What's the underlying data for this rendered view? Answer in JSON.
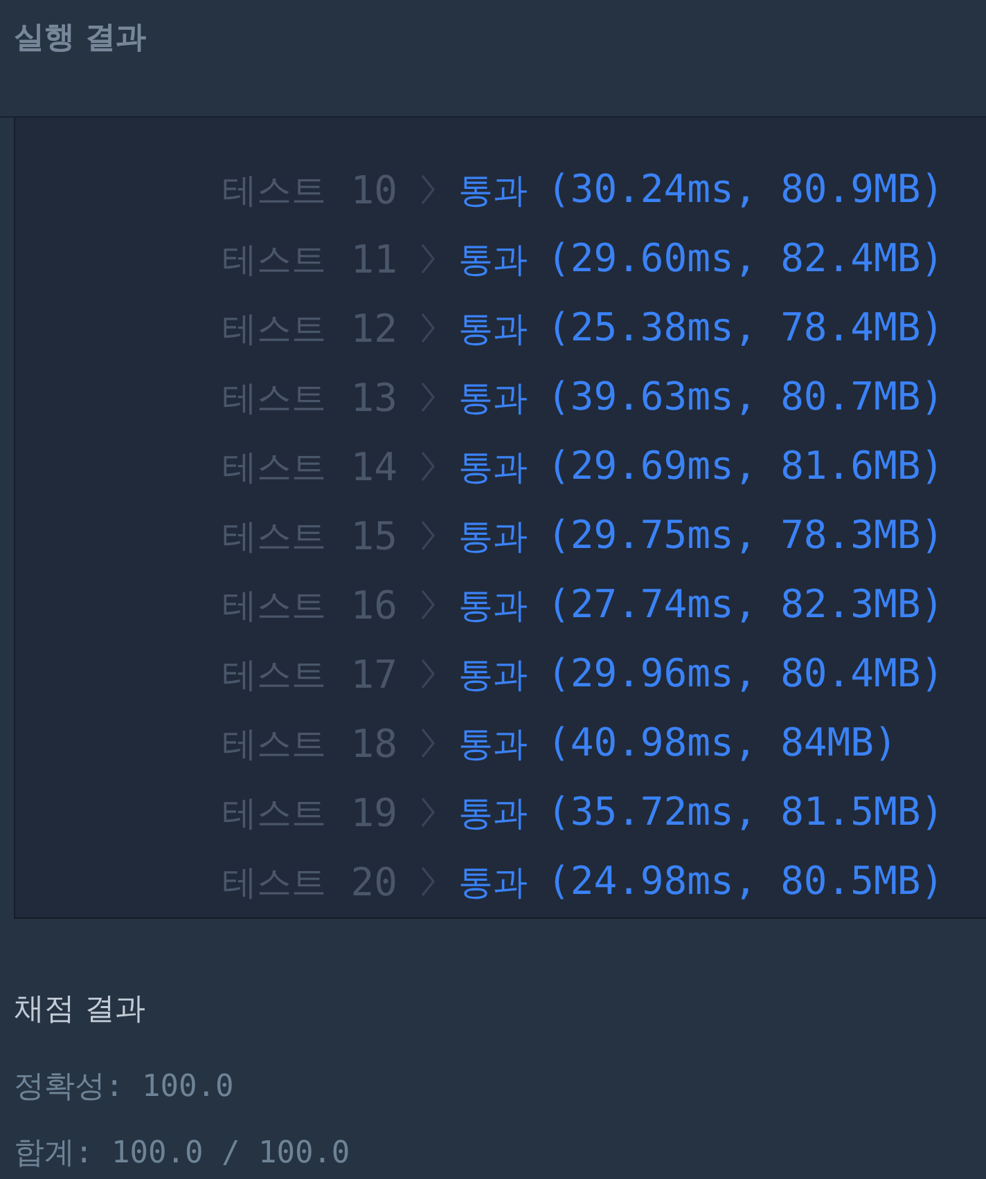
{
  "header": {
    "title": "실행 결과"
  },
  "results": [
    {
      "label": "테스트",
      "number": "10",
      "status": "통과",
      "detail": "(30.24ms, 80.9MB)",
      "passed": true
    },
    {
      "label": "테스트",
      "number": "11",
      "status": "통과",
      "detail": "(29.60ms, 82.4MB)",
      "passed": true
    },
    {
      "label": "테스트",
      "number": "12",
      "status": "통과",
      "detail": "(25.38ms, 78.4MB)",
      "passed": true
    },
    {
      "label": "테스트",
      "number": "13",
      "status": "통과",
      "detail": "(39.63ms, 80.7MB)",
      "passed": true
    },
    {
      "label": "테스트",
      "number": "14",
      "status": "통과",
      "detail": "(29.69ms, 81.6MB)",
      "passed": true
    },
    {
      "label": "테스트",
      "number": "15",
      "status": "통과",
      "detail": "(29.75ms, 78.3MB)",
      "passed": true
    },
    {
      "label": "테스트",
      "number": "16",
      "status": "통과",
      "detail": "(27.74ms, 82.3MB)",
      "passed": true
    },
    {
      "label": "테스트",
      "number": "17",
      "status": "통과",
      "detail": "(29.96ms, 80.4MB)",
      "passed": true
    },
    {
      "label": "테스트",
      "number": "18",
      "status": "통과",
      "detail": "(40.98ms, 84MB)",
      "passed": true
    },
    {
      "label": "테스트",
      "number": "19",
      "status": "통과",
      "detail": "(35.72ms, 81.5MB)",
      "passed": true
    },
    {
      "label": "테스트",
      "number": "20",
      "status": "통과",
      "detail": "(24.98ms, 80.5MB)",
      "passed": true
    }
  ],
  "grading": {
    "title": "채점 결과",
    "lines": [
      "정확성: 100.0",
      "합계: 100.0 / 100.0"
    ]
  }
}
